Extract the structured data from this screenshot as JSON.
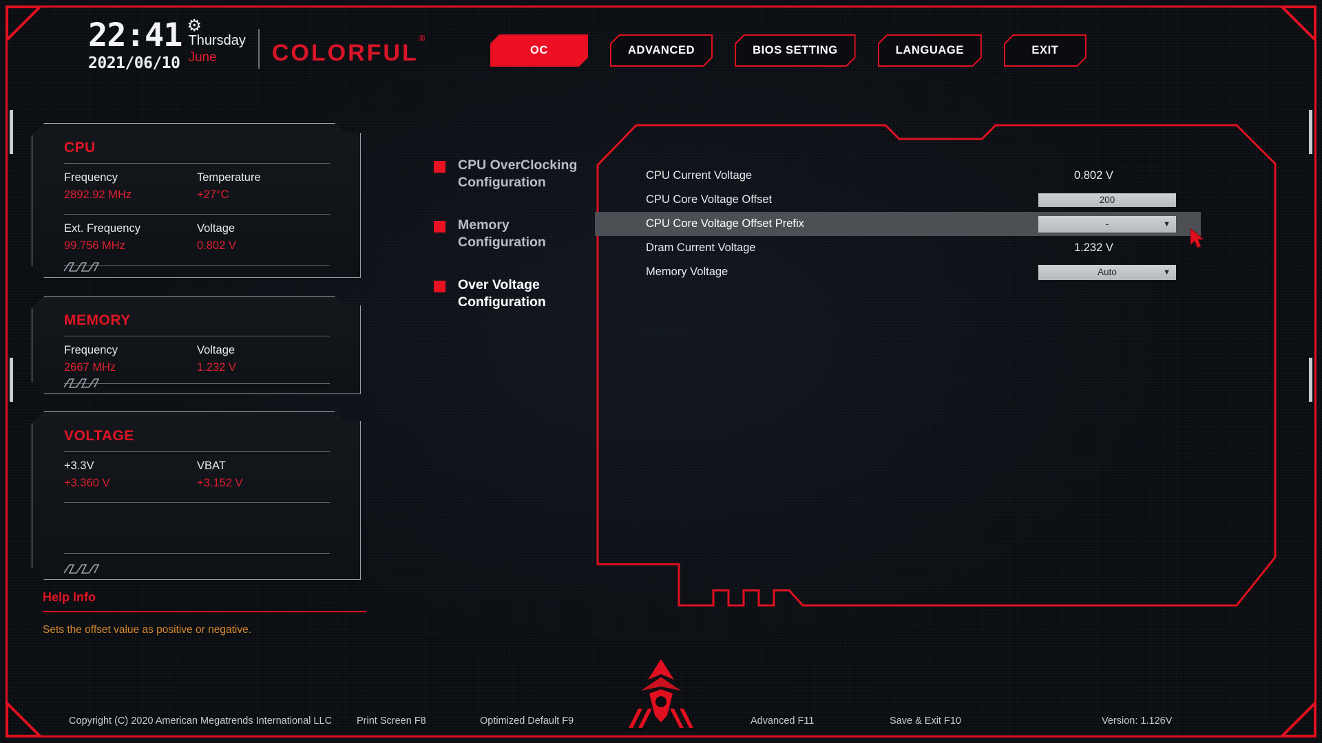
{
  "header": {
    "time": "22:41",
    "date": "2021/06/10",
    "weekday": "Thursday",
    "month": "June",
    "gear_icon": "gear-icon",
    "brand": "COLORFUL",
    "brand_mark": "®"
  },
  "nav": {
    "tabs": [
      {
        "label": "OC",
        "active": true
      },
      {
        "label": "ADVANCED",
        "active": false
      },
      {
        "label": "BIOS SETTING",
        "active": false
      },
      {
        "label": "LANGUAGE",
        "active": false
      },
      {
        "label": "EXIT",
        "active": false
      }
    ]
  },
  "panels": {
    "cpu": {
      "title": "CPU",
      "rows": [
        {
          "label_left": "Frequency",
          "value_left": "2892.92 MHz",
          "label_right": "Temperature",
          "value_right": "+27°C"
        },
        {
          "label_left": "Ext. Frequency",
          "value_left": "99.756 MHz",
          "label_right": "Voltage",
          "value_right": "0.802 V"
        }
      ]
    },
    "memory": {
      "title": "MEMORY",
      "rows": [
        {
          "label_left": "Frequency",
          "value_left": "2667 MHz",
          "label_right": "Voltage",
          "value_right": "1.232 V"
        }
      ]
    },
    "voltage": {
      "title": "VOLTAGE",
      "rows": [
        {
          "label_left": "+3.3V",
          "value_left": "+3.360 V",
          "label_right": "VBAT",
          "value_right": "+3.152 V"
        }
      ]
    }
  },
  "help": {
    "title": "Help Info",
    "text": "Sets the offset value as positive or negative."
  },
  "menu": {
    "items": [
      {
        "label": "CPU OverClocking Configuration",
        "active": false
      },
      {
        "label": "Memory Configuration",
        "active": false
      },
      {
        "label": "Over Voltage Configuration",
        "active": true
      }
    ]
  },
  "settings": {
    "rows": [
      {
        "label": "CPU Current Voltage",
        "type": "static",
        "value": "0.802 V",
        "highlight": false
      },
      {
        "label": "CPU Core Voltage Offset",
        "type": "field",
        "value": "200",
        "highlight": false
      },
      {
        "label": "CPU Core Voltage Offset Prefix",
        "type": "dropdown",
        "value": "-",
        "caret": "▼",
        "highlight": true
      },
      {
        "label": "Dram Current Voltage",
        "type": "static",
        "value": "1.232 V",
        "highlight": false
      },
      {
        "label": "Memory Voltage",
        "type": "dropdown",
        "value": "Auto",
        "caret": "▼",
        "highlight": false
      }
    ]
  },
  "footer": {
    "copyright": "Copyright (C) 2020 American Megatrends International LLC",
    "print_screen": "Print Screen F8",
    "optimized_default": "Optimized Default F9",
    "advanced": "Advanced F11",
    "save_exit": "Save & Exit F10",
    "version": "Version: 1.126V"
  },
  "colors": {
    "accent_red": "#e01020",
    "value_red": "#e02030",
    "help_orange": "#d98a30",
    "bg": "#0a0c10"
  }
}
